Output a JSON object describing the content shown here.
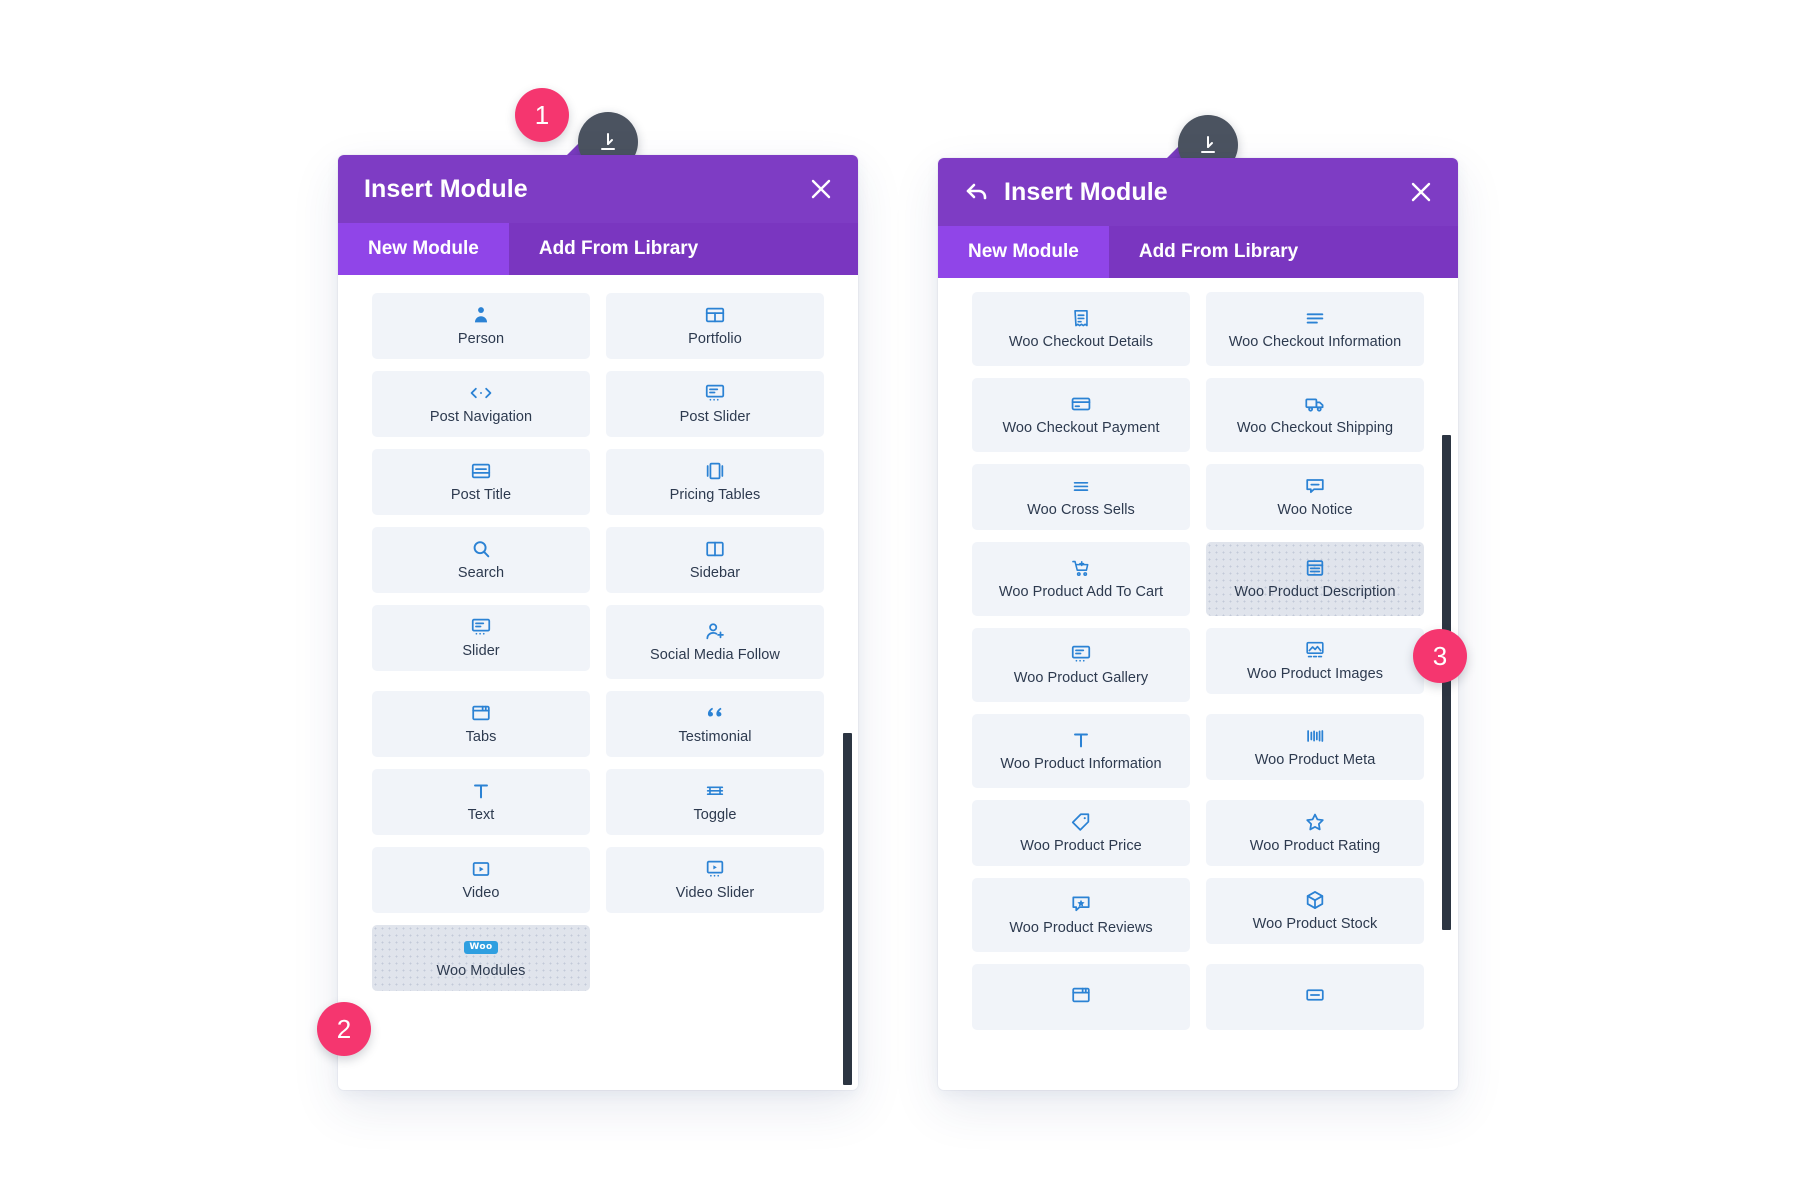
{
  "theme": {
    "header_purple": "#7e3cc4",
    "tabbar_purple": "#7a36c0",
    "tab_active_purple": "#9045e8",
    "card_bg": "#f1f4f9",
    "card_active_bg": "#e0e4ec",
    "icon_blue": "#2b82d4",
    "badge_pink": "#f5366f",
    "scrollbar_dark": "#2c3542",
    "handle_grey": "#4b5360"
  },
  "steps": [
    {
      "number": "1"
    },
    {
      "number": "2"
    },
    {
      "number": "3"
    }
  ],
  "left_modal": {
    "title": "Insert Module",
    "has_back_arrow": false,
    "close_icon": "close-icon",
    "tabs": [
      {
        "label": "New Module",
        "active": true
      },
      {
        "label": "Add From Library",
        "active": false
      }
    ],
    "modules": [
      {
        "label": "Person",
        "icon": "person-icon",
        "active": false
      },
      {
        "label": "Portfolio",
        "icon": "portfolio-grid-icon",
        "active": false
      },
      {
        "label": "Post Navigation",
        "icon": "post-navigation-icon",
        "active": false
      },
      {
        "label": "Post Slider",
        "icon": "post-slider-icon",
        "active": false
      },
      {
        "label": "Post Title",
        "icon": "post-title-icon",
        "active": false
      },
      {
        "label": "Pricing Tables",
        "icon": "pricing-tables-icon",
        "active": false
      },
      {
        "label": "Search",
        "icon": "search-icon",
        "active": false
      },
      {
        "label": "Sidebar",
        "icon": "sidebar-icon",
        "active": false
      },
      {
        "label": "Slider",
        "icon": "slider-icon",
        "active": false
      },
      {
        "label": "Social Media Follow",
        "icon": "social-media-follow-icon",
        "active": false
      },
      {
        "label": "Tabs",
        "icon": "tabs-icon",
        "active": false
      },
      {
        "label": "Testimonial",
        "icon": "quote-icon",
        "active": false
      },
      {
        "label": "Text",
        "icon": "text-icon",
        "active": false
      },
      {
        "label": "Toggle",
        "icon": "toggle-icon",
        "active": false
      },
      {
        "label": "Video",
        "icon": "video-icon",
        "active": false
      },
      {
        "label": "Video Slider",
        "icon": "video-slider-icon",
        "active": false
      },
      {
        "label": "Woo Modules",
        "icon": "woo-logo-icon",
        "active": true,
        "badge_text": "Woo"
      }
    ]
  },
  "right_modal": {
    "title": "Insert Module",
    "has_back_arrow": true,
    "back_icon": "back-arrow-icon",
    "close_icon": "close-icon",
    "tabs": [
      {
        "label": "New Module",
        "active": true
      },
      {
        "label": "Add From Library",
        "active": false
      }
    ],
    "modules": [
      {
        "label": "Woo Checkout Details",
        "icon": "checkout-details-icon",
        "active": false
      },
      {
        "label": "Woo Checkout Information",
        "icon": "checkout-information-icon",
        "active": false
      },
      {
        "label": "Woo Checkout Payment",
        "icon": "credit-card-icon",
        "active": false
      },
      {
        "label": "Woo Checkout Shipping",
        "icon": "truck-icon",
        "active": false
      },
      {
        "label": "Woo Cross Sells",
        "icon": "list-lines-icon",
        "active": false
      },
      {
        "label": "Woo Notice",
        "icon": "notice-bubble-icon",
        "active": false
      },
      {
        "label": "Woo Product Add To Cart",
        "icon": "add-to-cart-icon",
        "active": false
      },
      {
        "label": "Woo Product Description",
        "icon": "description-icon",
        "active": true
      },
      {
        "label": "Woo Product Gallery",
        "icon": "gallery-icon",
        "active": false
      },
      {
        "label": "Woo Product Images",
        "icon": "images-icon",
        "active": false
      },
      {
        "label": "Woo Product Information",
        "icon": "text-icon",
        "active": false
      },
      {
        "label": "Woo Product Meta",
        "icon": "meta-bars-icon",
        "active": false
      },
      {
        "label": "Woo Product Price",
        "icon": "price-tag-icon",
        "active": false
      },
      {
        "label": "Woo Product Rating",
        "icon": "star-icon",
        "active": false
      },
      {
        "label": "Woo Product Reviews",
        "icon": "review-bubble-icon",
        "active": false
      },
      {
        "label": "Woo Product Stock",
        "icon": "box-icon",
        "active": false
      },
      {
        "label": "",
        "icon": "tabs-icon",
        "active": false
      },
      {
        "label": "",
        "icon": "bar-icon",
        "active": false
      }
    ]
  }
}
